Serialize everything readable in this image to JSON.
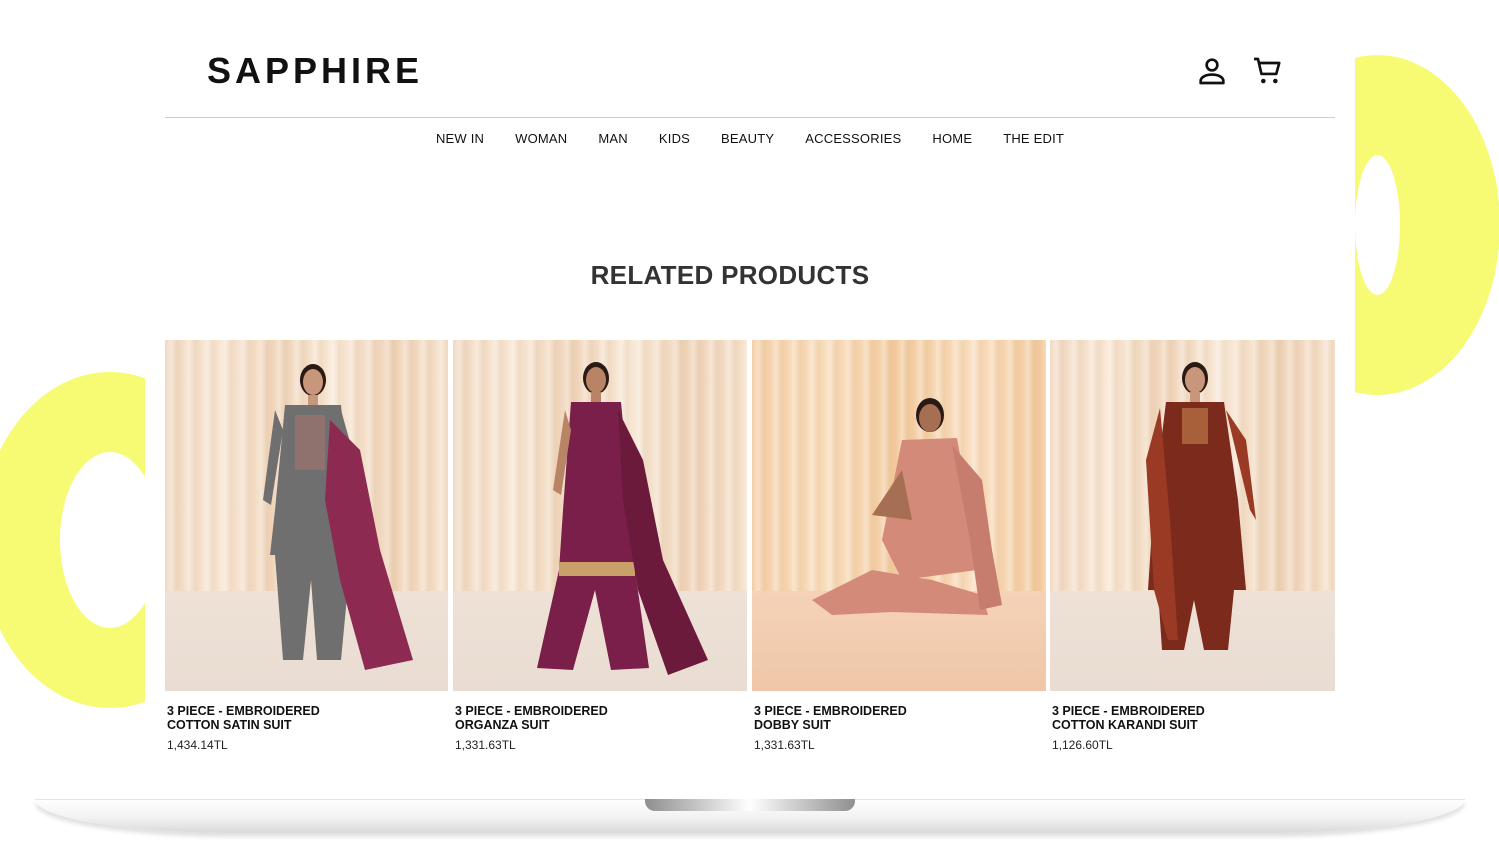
{
  "brand": {
    "logo": "SAPPHIRE"
  },
  "header": {
    "account_icon": "person-icon",
    "cart_icon": "shopping-cart-icon"
  },
  "nav": {
    "items": [
      "NEW IN",
      "WOMAN",
      "MAN",
      "KIDS",
      "BEAUTY",
      "ACCESSORIES",
      "HOME",
      "THE EDIT"
    ]
  },
  "related": {
    "title": "RELATED PRODUCTS",
    "products": [
      {
        "name": "3 PIECE - EMBROIDERED\nCOTTON SATIN SUIT",
        "price": "1,434.14TL",
        "outfit_color": "#6f6f6f",
        "dupatta_color": "#8c2a52"
      },
      {
        "name": "3 PIECE - EMBROIDERED\nORGANZA SUIT",
        "price": "1,331.63TL",
        "outfit_color": "#7a1f4a",
        "dupatta_color": "#6b1a3c"
      },
      {
        "name": "3 PIECE - EMBROIDERED\nDOBBY SUIT",
        "price": "1,331.63TL",
        "outfit_color": "#d38a78",
        "dupatta_color": "#c77d6d"
      },
      {
        "name": "3 PIECE - EMBROIDERED\nCOTTON KARANDI SUIT",
        "price": "1,126.60TL",
        "outfit_color": "#7b2a1c",
        "dupatta_color": "#9a3a24"
      }
    ]
  },
  "colors": {
    "accent_ring": "#f7fb74",
    "text": "#111111"
  }
}
